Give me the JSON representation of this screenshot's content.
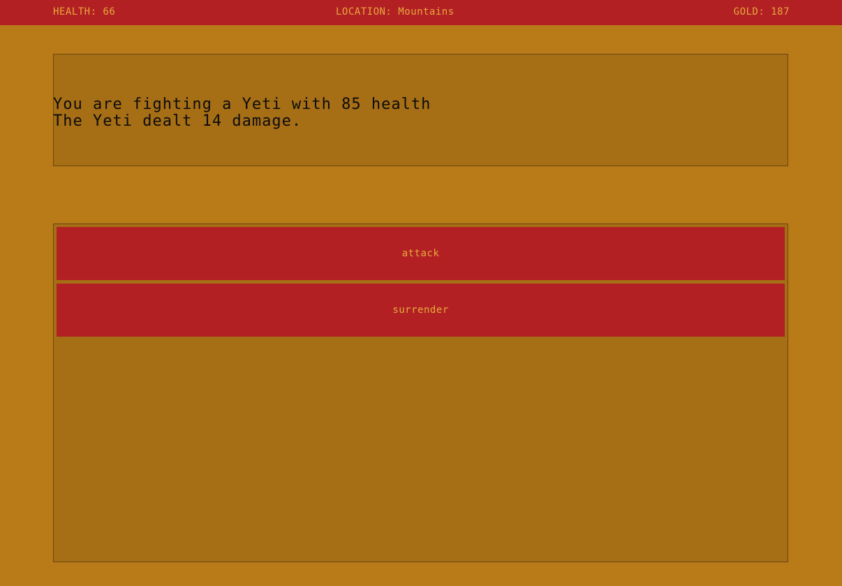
{
  "status_bar": {
    "health": "HEALTH: 66",
    "location": "LOCATION: Mountains",
    "gold": "GOLD: 187"
  },
  "message": {
    "lines": [
      "You are fighting a Yeti with 85 health",
      "The Yeti dealt 14 damage."
    ]
  },
  "actions": [
    {
      "label": "attack"
    },
    {
      "label": "surrender"
    }
  ],
  "colors": {
    "background": "#b97a18",
    "panel": "#a66e15",
    "accent_red": "#b22024",
    "accent_text": "#e7a93a",
    "message_text": "#0c0c0c"
  }
}
